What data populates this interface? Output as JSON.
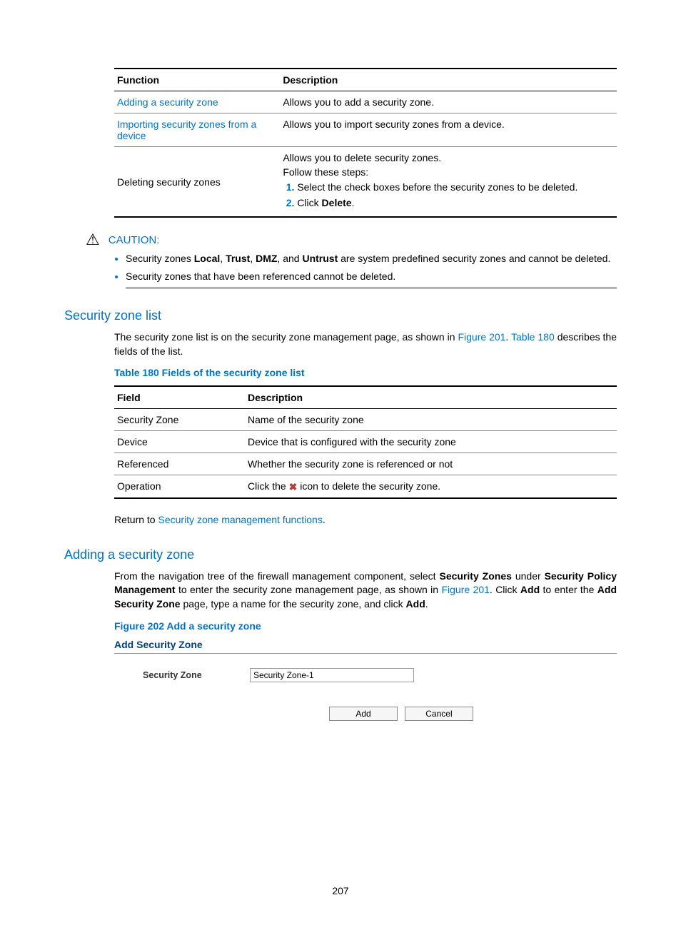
{
  "table1": {
    "head": {
      "c1": "Function",
      "c2": "Description"
    },
    "rows": [
      {
        "c1_link": "Adding a security zone",
        "c2": "Allows you to add a security zone."
      },
      {
        "c1_link": "Importing security zones from a device",
        "c2": "Allows you to import security zones from a device."
      },
      {
        "c1": "Deleting security zones",
        "c2a": "Allows you to delete security zones.",
        "c2b": "Follow these steps:",
        "c2c": "Select the check boxes before the security zones to be deleted.",
        "c2d_pre": "Click ",
        "c2d_bold": "Delete",
        "c2d_post": "."
      }
    ]
  },
  "caution": {
    "label": "CAUTION:",
    "bullets": [
      {
        "pre": "Security zones ",
        "b1": "Local",
        "s1": ", ",
        "b2": "Trust",
        "s2": ", ",
        "b3": "DMZ",
        "s3": ", and ",
        "b4": "Untrust",
        "post": " are system predefined security zones and cannot be deleted."
      },
      {
        "text": "Security zones that have been referenced cannot be deleted."
      }
    ]
  },
  "sec_zone_list": {
    "heading": "Security zone list",
    "para_pre": "The security zone list is on the security zone management page, as shown in ",
    "fig_link": "Figure 201",
    "para_mid": ". ",
    "tab_link": "Table 180",
    "para_post": " describes the fields of the list.",
    "table_caption": "Table 180 Fields of the security zone list"
  },
  "table2": {
    "head": {
      "c1": "Field",
      "c2": "Description"
    },
    "rows": [
      {
        "c1": "Security Zone",
        "c2": "Name of the security zone"
      },
      {
        "c1": "Device",
        "c2": "Device that is configured with the security zone"
      },
      {
        "c1": "Referenced",
        "c2": "Whether the security zone is referenced or not"
      },
      {
        "c1": "Operation",
        "c2_pre": "Click the ",
        "c2_post": " icon to delete the security zone."
      }
    ]
  },
  "return_line": {
    "pre": "Return to ",
    "link": "Security zone management functions",
    "post": "."
  },
  "adding": {
    "heading": "Adding a security zone",
    "p_pre": "From the navigation tree of the firewall management component, select ",
    "b1": "Security Zones",
    "s1": " under ",
    "b2": "Security Policy Management",
    "s2": " to enter the security zone management page, as shown in ",
    "fig_link": "Figure 201",
    "s3": ". Click ",
    "b3": "Add",
    "s4": " to enter the ",
    "b4": "Add Security Zone",
    "s5": " page, type a name for the security zone, and click ",
    "b5": "Add",
    "s6": ".",
    "fig_caption": "Figure 202 Add a security zone"
  },
  "screenshot": {
    "title": "Add Security Zone",
    "field_label": "Security Zone",
    "field_value": "Security Zone-1",
    "btn_add": "Add",
    "btn_cancel": "Cancel"
  },
  "page_number": "207"
}
